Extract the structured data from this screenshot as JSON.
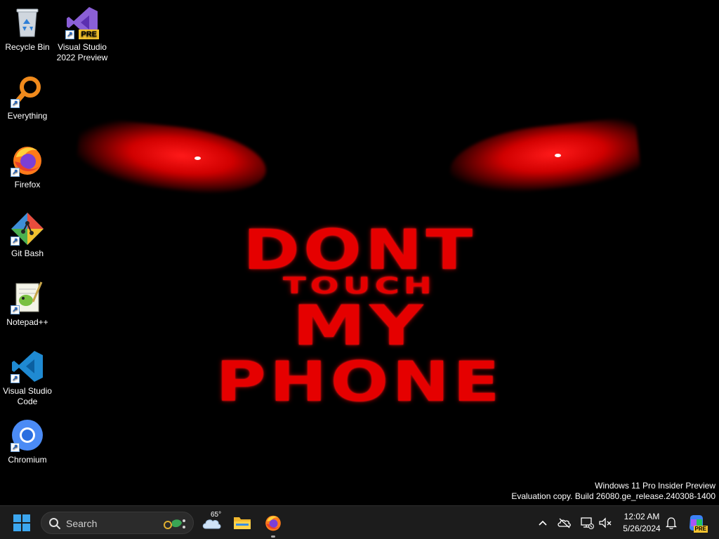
{
  "wallpaper": {
    "line1": "DONT",
    "line2": "TOUCH",
    "line3": "MY",
    "line4": "PHONE",
    "accent_color": "#e50000"
  },
  "desktop_icons": [
    {
      "label": "Recycle Bin",
      "icon": "recycle-bin-icon"
    },
    {
      "label": "Visual Studio 2022 Preview",
      "icon": "visual-studio-preview-icon",
      "badge": "PRE"
    },
    {
      "label": "Everything",
      "icon": "everything-search-icon"
    },
    {
      "label": "Firefox",
      "icon": "firefox-icon"
    },
    {
      "label": "Git Bash",
      "icon": "git-bash-icon"
    },
    {
      "label": "Notepad++",
      "icon": "notepad-plus-plus-icon"
    },
    {
      "label": "Visual Studio Code",
      "icon": "vscode-icon"
    },
    {
      "label": "Chromium",
      "icon": "chromium-icon"
    }
  ],
  "watermark": {
    "line1": "Windows 11 Pro Insider Preview",
    "line2": "Evaluation copy. Build 26080.ge_release.240308-1400"
  },
  "taskbar": {
    "search_label": "Search",
    "weather_temp": "65°",
    "clock_time": "12:02 AM",
    "clock_date": "5/26/2024",
    "copilot_badge": "PRE"
  }
}
